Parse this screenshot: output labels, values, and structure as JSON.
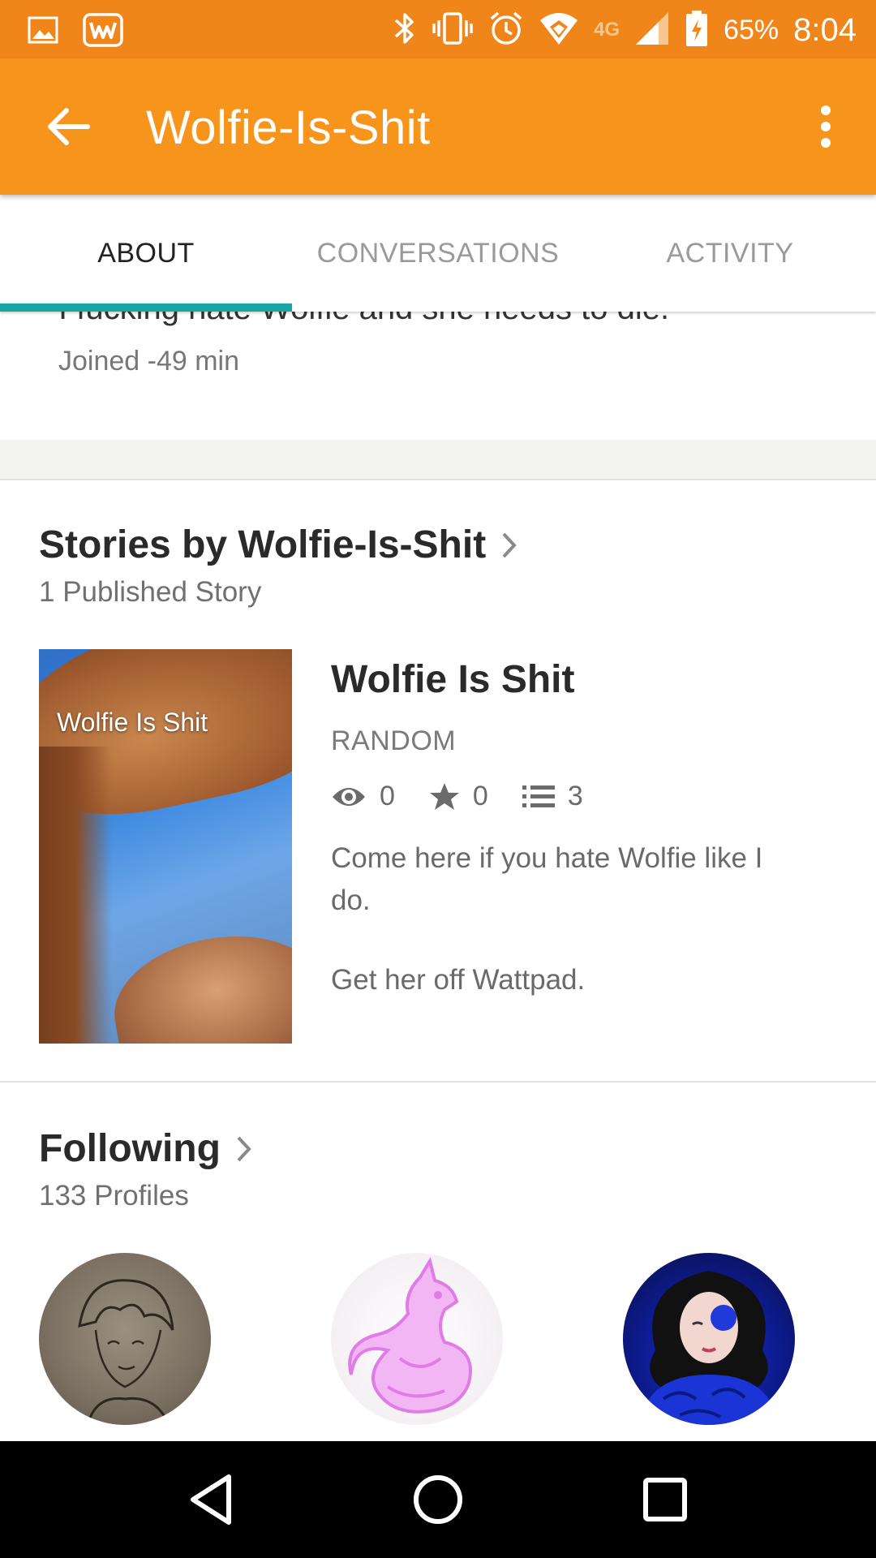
{
  "status_bar": {
    "network": "4G",
    "battery": "65%",
    "time": "8:04",
    "icons": [
      "image-icon",
      "wattpad-icon",
      "bluetooth-icon",
      "vibrate-icon",
      "alarm-icon",
      "wifi-icon",
      "signal-icon",
      "battery-charging-icon"
    ]
  },
  "app_bar": {
    "title": "Wolfie-Is-Shit",
    "background": "#f7941c"
  },
  "tabs": [
    {
      "label": "ABOUT",
      "active": true
    },
    {
      "label": "CONVERSATIONS",
      "active": false
    },
    {
      "label": "ACTIVITY",
      "active": false
    }
  ],
  "tab_indicator_color": "#19a4a6",
  "profile": {
    "bio": "I fucking hate Wolfie and she needs to die.",
    "joined": "Joined -49 min"
  },
  "stories": {
    "heading": "Stories by Wolfie-Is-Shit",
    "count": "1 Published Story",
    "items": [
      {
        "cover_title": "Wolfie Is Shit",
        "title": "Wolfie Is Shit",
        "genre": "RANDOM",
        "reads": "0",
        "votes": "0",
        "parts": "3",
        "description_1": "Come here if you hate Wolfie like I do.",
        "description_2": "Get her off Wattpad."
      }
    ]
  },
  "following": {
    "heading": "Following",
    "count": "133 Profiles"
  }
}
